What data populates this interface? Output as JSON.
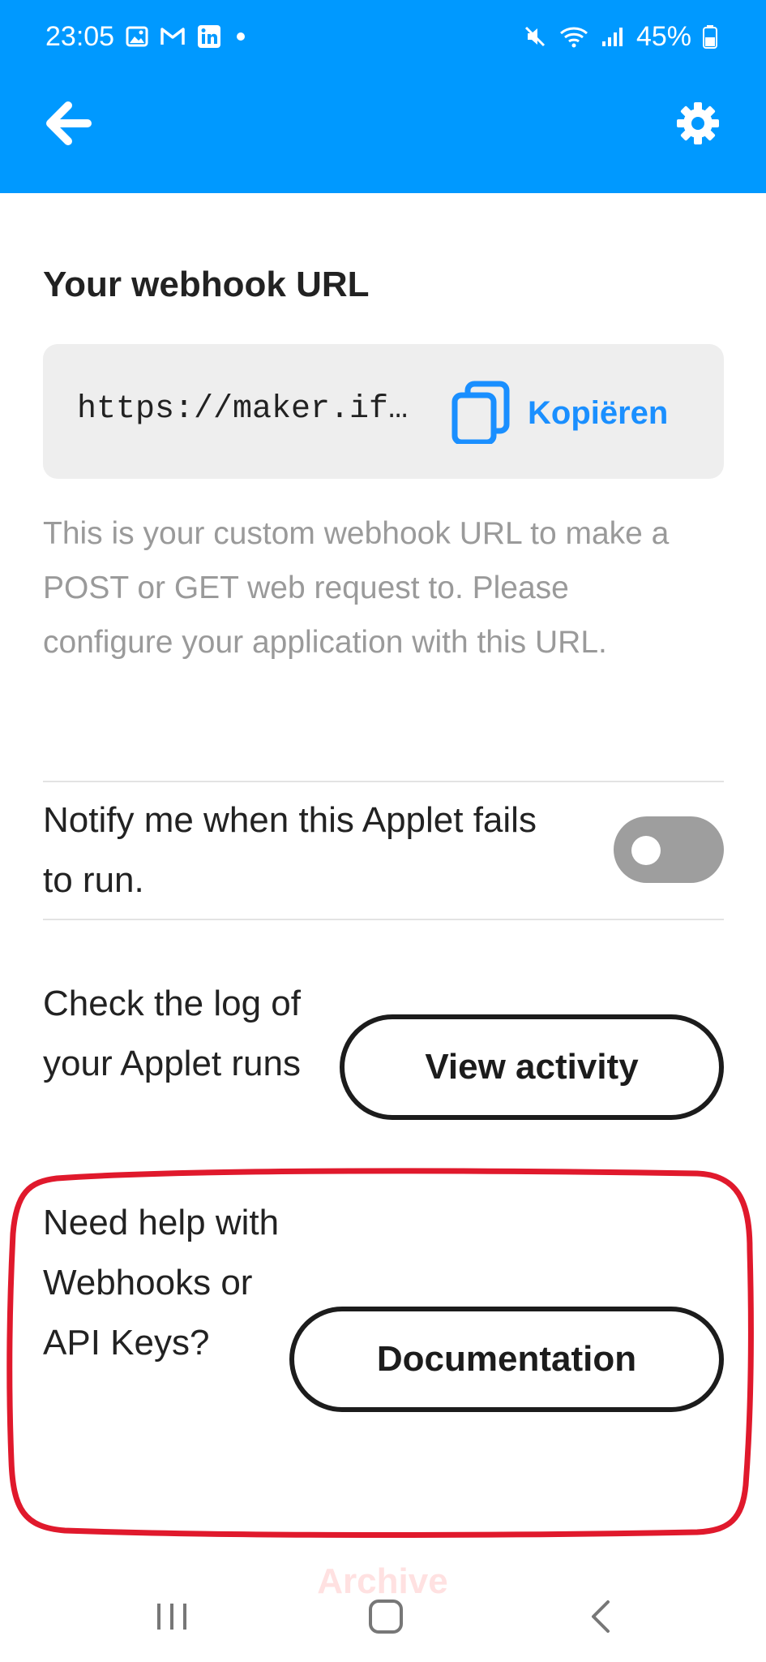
{
  "status_bar": {
    "time": "23:05",
    "battery_percent": "45%",
    "left_icons": [
      "image-notification-icon",
      "gmail-icon",
      "linkedin-icon",
      "dot-icon"
    ],
    "right_icons": [
      "mute-icon",
      "wifi-icon",
      "signal-icon",
      "battery-icon"
    ]
  },
  "app_bar": {
    "color": "#0099ff",
    "back_icon": "arrow-left-icon",
    "settings_icon": "gear-icon"
  },
  "webhook": {
    "title": "Your webhook URL",
    "url": "https://maker.if…",
    "copy_label": "Kopiëren",
    "description": "This is your custom webhook URL to make a POST or GET web request to. Please configure your application with this URL."
  },
  "notify": {
    "label": "Notify me when this Applet fails to run.",
    "enabled": false
  },
  "activity": {
    "label": "Check the log of your Applet runs",
    "button_label": "View activity"
  },
  "help": {
    "label": "Need help with Webhooks or API Keys?",
    "button_label": "Documentation"
  },
  "watermark": "Archive",
  "nav_bar": {
    "icons": [
      "recent-apps-icon",
      "home-icon",
      "back-icon"
    ]
  },
  "colors": {
    "accent": "#0099ff",
    "link": "#1a8fff",
    "annotation": "#e0192c"
  }
}
